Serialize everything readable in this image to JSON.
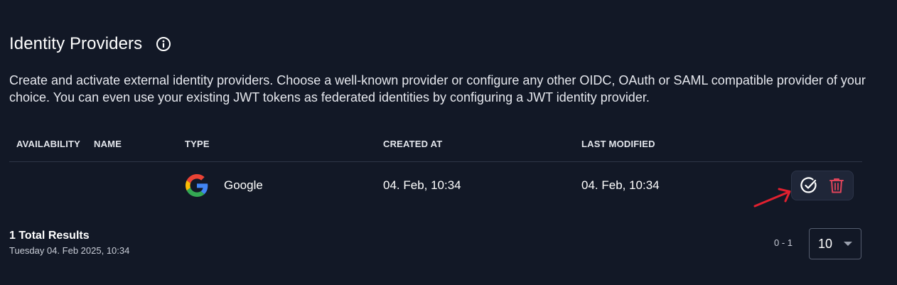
{
  "header": {
    "title": "Identity Providers",
    "info_icon": "info-circle-icon",
    "description": "Create and activate external identity providers. Choose a well-known provider or configure any other OIDC, OAuth or SAML compatible provider of your choice. You can even use your existing JWT tokens as federated identities by configuring a JWT identity provider."
  },
  "table": {
    "columns": [
      "AVAILABILITY",
      "NAME",
      "TYPE",
      "CREATED AT",
      "LAST MODIFIED"
    ],
    "rows": [
      {
        "availability": "",
        "name": "",
        "type_icon": "google-icon",
        "type": "Google",
        "created_at": "04. Feb, 10:34",
        "last_modified": "04. Feb, 10:34",
        "actions": [
          "activate-check-icon",
          "delete-trash-icon"
        ]
      }
    ]
  },
  "footer": {
    "total": "1 Total Results",
    "timestamp": "Tuesday 04. Feb 2025, 10:34",
    "range": "0 - 1",
    "page_size": "10"
  },
  "colors": {
    "background": "#121826",
    "delete_accent": "#e0445a",
    "annotation_arrow": "#e0202f"
  }
}
